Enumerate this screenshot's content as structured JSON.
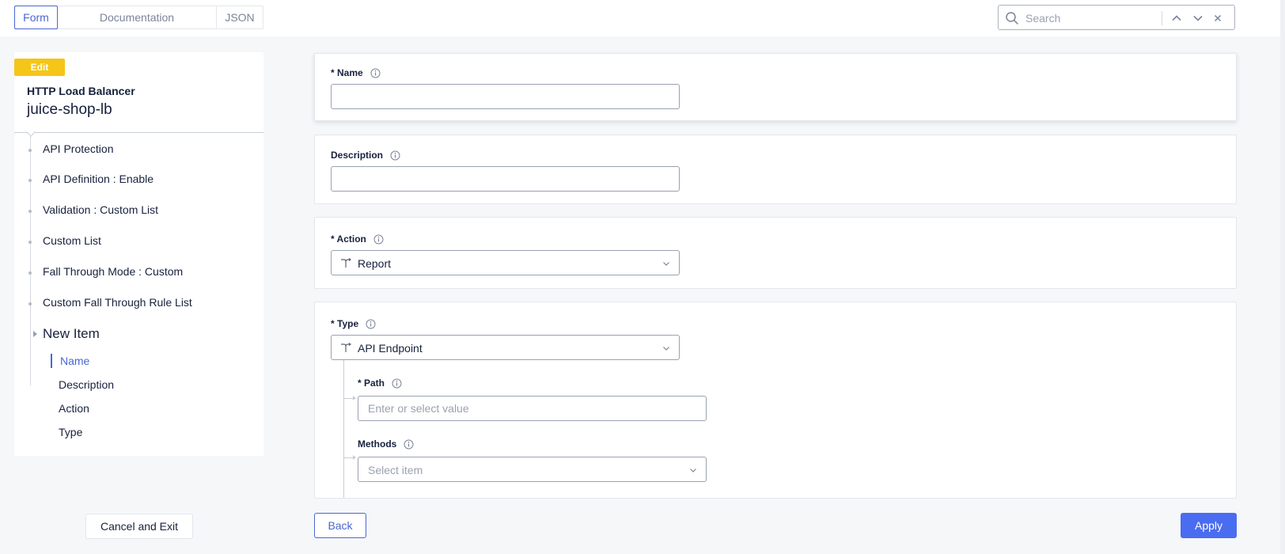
{
  "tabs": [
    {
      "label": "Form",
      "active": true
    },
    {
      "label": "Documentation",
      "active": false
    },
    {
      "label": "JSON",
      "active": false
    }
  ],
  "search": {
    "placeholder": "Search",
    "value": ""
  },
  "sidebar": {
    "badge": "Edit",
    "object_kind": "HTTP Load Balancer",
    "object_name": "juice-shop-lb",
    "items": [
      {
        "label": "API Protection"
      },
      {
        "label": "API Definition : Enable"
      },
      {
        "label": "Validation : Custom List"
      },
      {
        "label": "Custom List"
      },
      {
        "label": "Fall Through Mode : Custom"
      },
      {
        "label": "Custom Fall Through Rule List"
      }
    ],
    "current": {
      "label": "New Item",
      "sections": [
        {
          "label": "Name",
          "active": true
        },
        {
          "label": "Description",
          "active": false
        },
        {
          "label": "Action",
          "active": false
        },
        {
          "label": "Type",
          "active": false
        }
      ]
    },
    "cancel_label": "Cancel and Exit"
  },
  "form": {
    "name": {
      "label": "* Name",
      "value": ""
    },
    "description": {
      "label": "Description",
      "value": ""
    },
    "action": {
      "label": "* Action",
      "value": "Report"
    },
    "type": {
      "label": "* Type",
      "value": "API Endpoint",
      "path": {
        "label": "* Path",
        "placeholder": "Enter or select value",
        "value": ""
      },
      "methods": {
        "label": "Methods",
        "placeholder": "Select item"
      }
    }
  },
  "footer": {
    "back_label": "Back",
    "apply_label": "Apply"
  },
  "colors": {
    "accent": "#4967d3",
    "primary_button": "#4a6cf0",
    "badge": "#f5c518"
  },
  "icons": [
    "search-icon",
    "chevron-up-icon",
    "chevron-down-icon",
    "close-icon",
    "info-icon",
    "fork-icon"
  ]
}
